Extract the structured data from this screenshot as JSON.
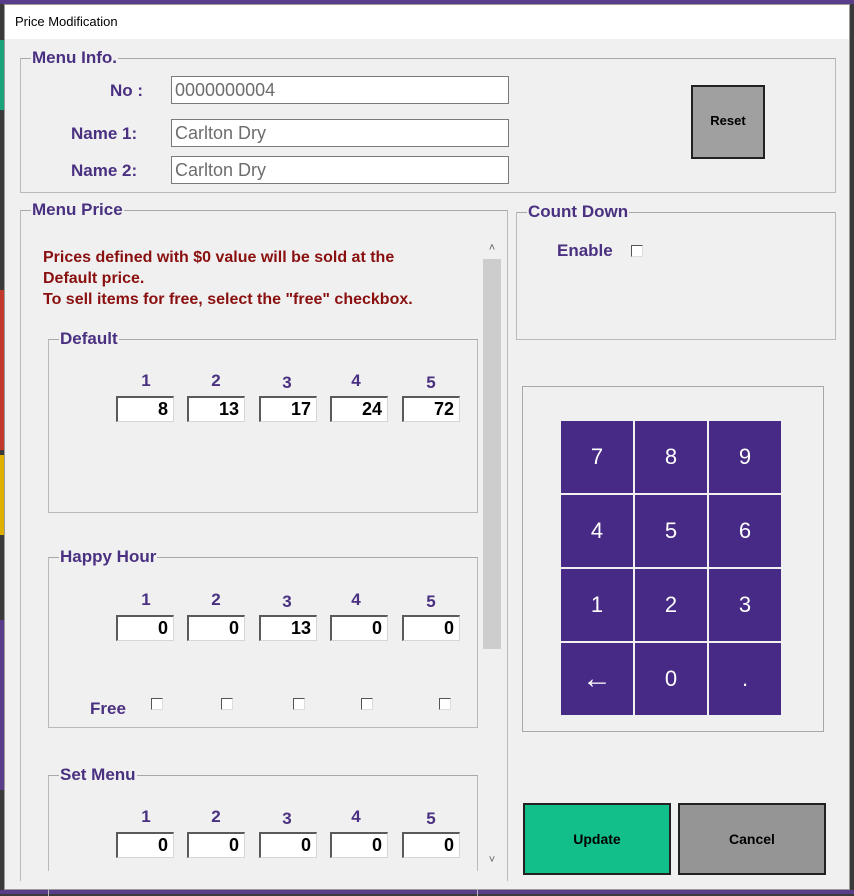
{
  "dialog": {
    "title": "Price Modification"
  },
  "menu_info": {
    "legend": "Menu Info.",
    "no_label": "No :",
    "no_value": "0000000004",
    "name1_label": "Name 1:",
    "name1_value": "Carlton Dry",
    "name2_label": "Name 2:",
    "name2_value": "Carlton Dry",
    "reset_label": "Reset"
  },
  "menu_price": {
    "legend": "Menu Price",
    "warning_line1": "Prices defined with $0 value will be sold at the",
    "warning_line2": "Default price.",
    "warning_line3": "To sell items for free, select the \"free\" checkbox.",
    "columns": [
      "1",
      "2",
      "3",
      "4",
      "5"
    ],
    "default": {
      "legend": "Default",
      "values": [
        "8",
        "13",
        "17",
        "24",
        "72"
      ]
    },
    "happy_hour": {
      "legend": "Happy Hour",
      "values": [
        "0",
        "0",
        "13",
        "0",
        "0"
      ],
      "free_label": "Free",
      "free_checked": [
        false,
        false,
        false,
        false,
        false
      ]
    },
    "set_menu": {
      "legend": "Set Menu",
      "values": [
        "0",
        "0",
        "0",
        "0",
        "0"
      ]
    },
    "scroll_up_icon": "chevron-up-icon",
    "scroll_down_icon": "chevron-down-icon"
  },
  "count_down": {
    "legend": "Count Down",
    "enable_label": "Enable",
    "enable_checked": false
  },
  "keypad": {
    "keys": [
      "7",
      "8",
      "9",
      "4",
      "5",
      "6",
      "1",
      "2",
      "3",
      "←",
      "0",
      "."
    ],
    "color": "#472a85"
  },
  "actions": {
    "update_label": "Update",
    "update_color": "#12bf8a",
    "cancel_label": "Cancel",
    "cancel_color": "#959595"
  }
}
